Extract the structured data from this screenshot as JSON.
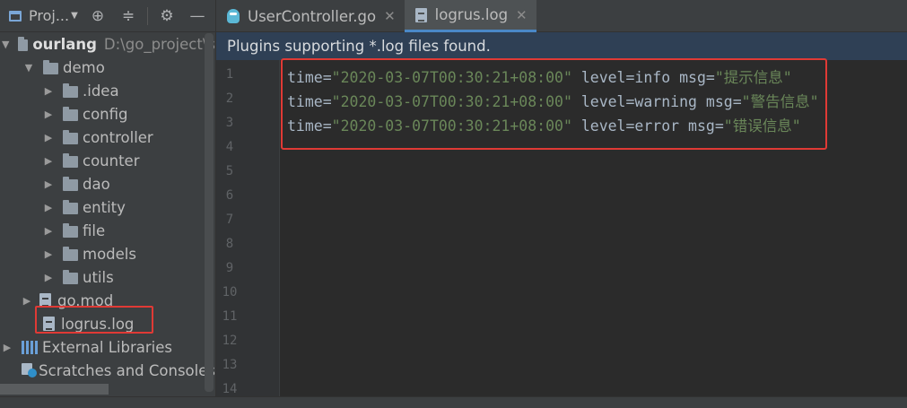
{
  "toolbar": {
    "project_label": "Proj...",
    "locate_icon": "crosshair-icon",
    "collapse_icon": "collapse-all-icon",
    "settings_icon": "gear-icon",
    "hide_icon": "minimize-icon"
  },
  "tree": {
    "root": {
      "label": "ourlang",
      "path": "D:\\go_project\\s"
    },
    "demo": "demo",
    "folders": [
      ".idea",
      "config",
      "controller",
      "counter",
      "dao",
      "entity",
      "file",
      "models",
      "utils"
    ],
    "files": [
      "go.mod",
      "logrus.log"
    ],
    "external_libraries": "External Libraries",
    "scratches": "Scratches and Consoles"
  },
  "tabs": [
    {
      "label": "UserController.go",
      "icon": "go-file-icon",
      "active": false
    },
    {
      "label": "logrus.log",
      "icon": "log-file-icon",
      "active": true
    }
  ],
  "banner": {
    "text": "Plugins supporting *.log files found."
  },
  "editor": {
    "line_numbers": [
      "1",
      "2",
      "3",
      "4",
      "5",
      "6",
      "7",
      "8",
      "9",
      "10",
      "11",
      "12",
      "13",
      "14"
    ],
    "lines": [
      {
        "k1": "time=",
        "v1": "\"2020-03-07T00:30:21+08:00\"",
        "k2": " level=info msg=",
        "v2": "\"提示信息\""
      },
      {
        "k1": "time=",
        "v1": "\"2020-03-07T00:30:21+08:00\"",
        "k2": " level=warning msg=",
        "v2": "\"警告信息\""
      },
      {
        "k1": "time=",
        "v1": "\"2020-03-07T00:30:21+08:00\"",
        "k2": " level=error msg=",
        "v2": "\"错误信息\""
      }
    ]
  },
  "status": {
    "text": ""
  },
  "colors": {
    "highlight_border": "#e03a35",
    "banner_bg": "#2f4055",
    "string_color": "#6a8759",
    "key_color": "#a9b7c6"
  }
}
